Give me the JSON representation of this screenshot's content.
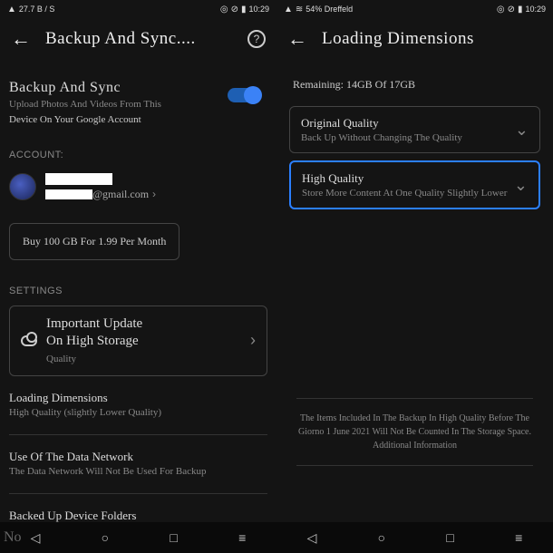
{
  "left": {
    "status": {
      "net": "27.7 B / S",
      "time": "10:29"
    },
    "title": "Backup And Sync....",
    "backup_sync": {
      "heading": "Backup And Sync",
      "desc1": "Upload Photos And Videos From This",
      "desc2": "Device On Your Google Account"
    },
    "account_label": "ACCOUNT:",
    "email_suffix": "@gmail.com",
    "buy": "Buy 100 GB For 1.99 Per Month",
    "settings_label": "SETTINGS",
    "important": {
      "line1": "Important Update",
      "line2": "On High Storage",
      "line3": "Quality"
    },
    "loading": {
      "title": "Loading Dimensions",
      "sub": "High Quality (slightly Lower Quality)"
    },
    "datanet": {
      "title": "Use Of The Data Network",
      "sub": "The Data Network Will Not Be Used For Backup"
    },
    "folders": "Backed Up Device Folders",
    "nav_left": "No"
  },
  "right": {
    "status": {
      "net": "54% Dreffeld",
      "time": "10:29"
    },
    "title": "Loading Dimensions",
    "remaining": "Remaining: 14GB Of 17GB",
    "opt1": {
      "title": "Original Quality",
      "sub": "Back Up Without Changing The Quality"
    },
    "opt2": {
      "title": "High Quality",
      "sub": "Store More Content At One Quality Slightly Lower"
    },
    "note": "The Items Included In The Backup In High Quality Before The Giorno 1 June 2021 Will Not Be Counted In The Storage Space. Additional Information"
  }
}
